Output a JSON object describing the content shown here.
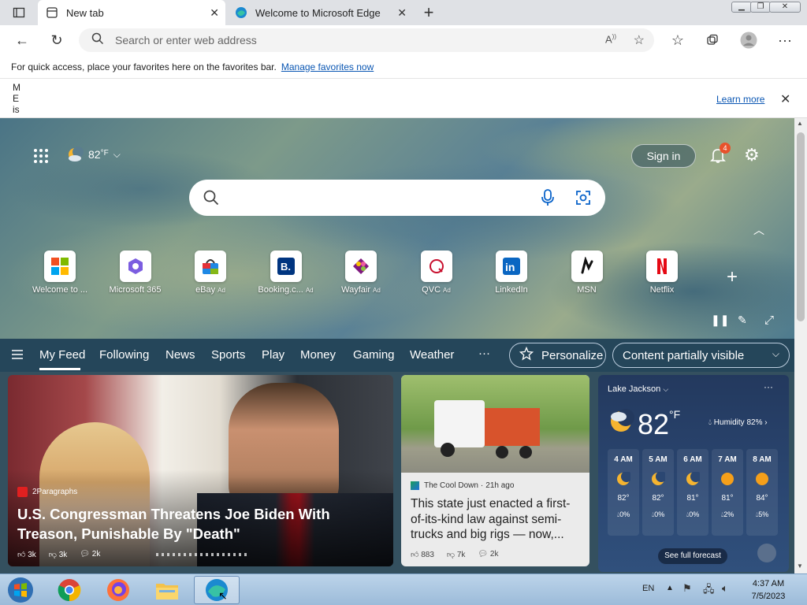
{
  "tabs": [
    {
      "label": "New tab",
      "icon": "newtab-icon"
    },
    {
      "label": "Welcome to Microsoft Edge",
      "icon": "edge-icon"
    }
  ],
  "address": {
    "placeholder": "Search or enter web address"
  },
  "favorites_hint": {
    "text": "For quick access, place your favorites here on the favorites bar.",
    "link": "Manage favorites now"
  },
  "infobar": {
    "stub_lines": [
      "M",
      "E",
      "is"
    ],
    "learn_more": "Learn more"
  },
  "ntp": {
    "weather_temp": "82",
    "weather_unit": "°F",
    "sign_in": "Sign in",
    "notification_count": "4",
    "quick_links": [
      {
        "label": "Welcome to ...",
        "ad": ""
      },
      {
        "label": "Microsoft 365",
        "ad": ""
      },
      {
        "label": "eBay",
        "ad": "Ad"
      },
      {
        "label": "Booking.c...",
        "ad": "Ad"
      },
      {
        "label": "Wayfair",
        "ad": "Ad"
      },
      {
        "label": "QVC",
        "ad": "Ad"
      },
      {
        "label": "LinkedIn",
        "ad": ""
      },
      {
        "label": "MSN",
        "ad": ""
      },
      {
        "label": "Netflix",
        "ad": ""
      }
    ]
  },
  "feed": {
    "nav": [
      "My Feed",
      "Following",
      "News",
      "Sports",
      "Play",
      "Money",
      "Gaming",
      "Weather"
    ],
    "more": "···",
    "personalize": "Personalize",
    "content_visibility": "Content partially visible"
  },
  "cards": {
    "main": {
      "source": "2Paragraphs",
      "headline": "U.S. Congressman Threatens Joe Biden With Treason, Punishable By \"Death\"",
      "likes": "3k",
      "dislikes": "3k",
      "comments": "2k"
    },
    "second": {
      "source": "The Cool Down",
      "age": "21h ago",
      "headline": "This state just enacted a first-of-its-kind law against semi-trucks and big rigs — now,...",
      "likes": "883",
      "dislikes": "7k",
      "comments": "2k"
    },
    "weather": {
      "location": "Lake Jackson",
      "temp": "82",
      "unit": "°F",
      "humidity": "Humidity 82%",
      "hours": [
        {
          "time": "4 AM",
          "icon": "moon-icon",
          "temp": "82°",
          "precip": "0%"
        },
        {
          "time": "5 AM",
          "icon": "moon-icon",
          "temp": "82°",
          "precip": "0%"
        },
        {
          "time": "6 AM",
          "icon": "moon-icon",
          "temp": "81°",
          "precip": "0%"
        },
        {
          "time": "7 AM",
          "icon": "sun-icon",
          "temp": "81°",
          "precip": "2%"
        },
        {
          "time": "8 AM",
          "icon": "sun-icon",
          "temp": "84°",
          "precip": "5%"
        }
      ],
      "forecast_btn": "See full forecast"
    }
  },
  "taskbar": {
    "lang": "EN",
    "time": "4:37 AM",
    "date": "7/5/2023"
  }
}
